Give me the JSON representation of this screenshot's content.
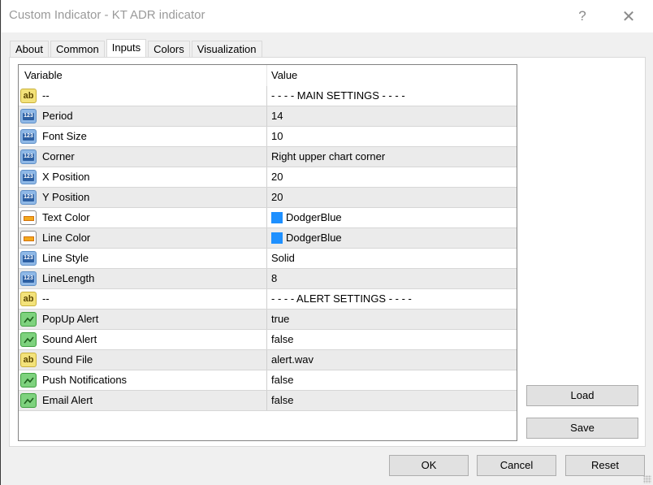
{
  "window": {
    "title": "Custom Indicator - KT ADR indicator",
    "help_label": "?",
    "close_label": "✕"
  },
  "tabs": [
    {
      "label": "About",
      "active": false
    },
    {
      "label": "Common",
      "active": false
    },
    {
      "label": "Inputs",
      "active": true
    },
    {
      "label": "Colors",
      "active": false
    },
    {
      "label": "Visualization",
      "active": false
    }
  ],
  "grid": {
    "headers": {
      "variable": "Variable",
      "value": "Value"
    },
    "rows": [
      {
        "type": "string",
        "variable": "--",
        "value": "- - - - MAIN SETTINGS - - - -"
      },
      {
        "type": "int",
        "variable": "Period",
        "value": "14"
      },
      {
        "type": "int",
        "variable": "Font Size",
        "value": "10"
      },
      {
        "type": "int",
        "variable": "Corner",
        "value": "Right upper chart corner"
      },
      {
        "type": "int",
        "variable": "X Position",
        "value": "20"
      },
      {
        "type": "int",
        "variable": "Y Position",
        "value": "20"
      },
      {
        "type": "color",
        "variable": "Text Color",
        "value": "DodgerBlue",
        "swatch": "#1e90ff"
      },
      {
        "type": "color",
        "variable": "Line Color",
        "value": "DodgerBlue",
        "swatch": "#1e90ff"
      },
      {
        "type": "int",
        "variable": "Line Style",
        "value": "Solid"
      },
      {
        "type": "int",
        "variable": "LineLength",
        "value": "8"
      },
      {
        "type": "string",
        "variable": "--",
        "value": "- - - - ALERT SETTINGS - - - -"
      },
      {
        "type": "bool",
        "variable": "PopUp Alert",
        "value": "true"
      },
      {
        "type": "bool",
        "variable": "Sound Alert",
        "value": "false"
      },
      {
        "type": "string",
        "variable": "Sound File",
        "value": "alert.wav"
      },
      {
        "type": "bool",
        "variable": "Push Notifications",
        "value": "false"
      },
      {
        "type": "bool",
        "variable": "Email Alert",
        "value": "false"
      }
    ]
  },
  "icons": {
    "string": {
      "name": "string-type-icon",
      "glyph": "ab"
    },
    "int": {
      "name": "integer-type-icon",
      "glyph": "123"
    },
    "color": {
      "name": "color-type-icon",
      "glyph": ""
    },
    "bool": {
      "name": "boolean-type-icon",
      "glyph": ""
    }
  },
  "buttons": {
    "load": "Load",
    "save": "Save",
    "ok": "OK",
    "cancel": "Cancel",
    "reset": "Reset"
  }
}
